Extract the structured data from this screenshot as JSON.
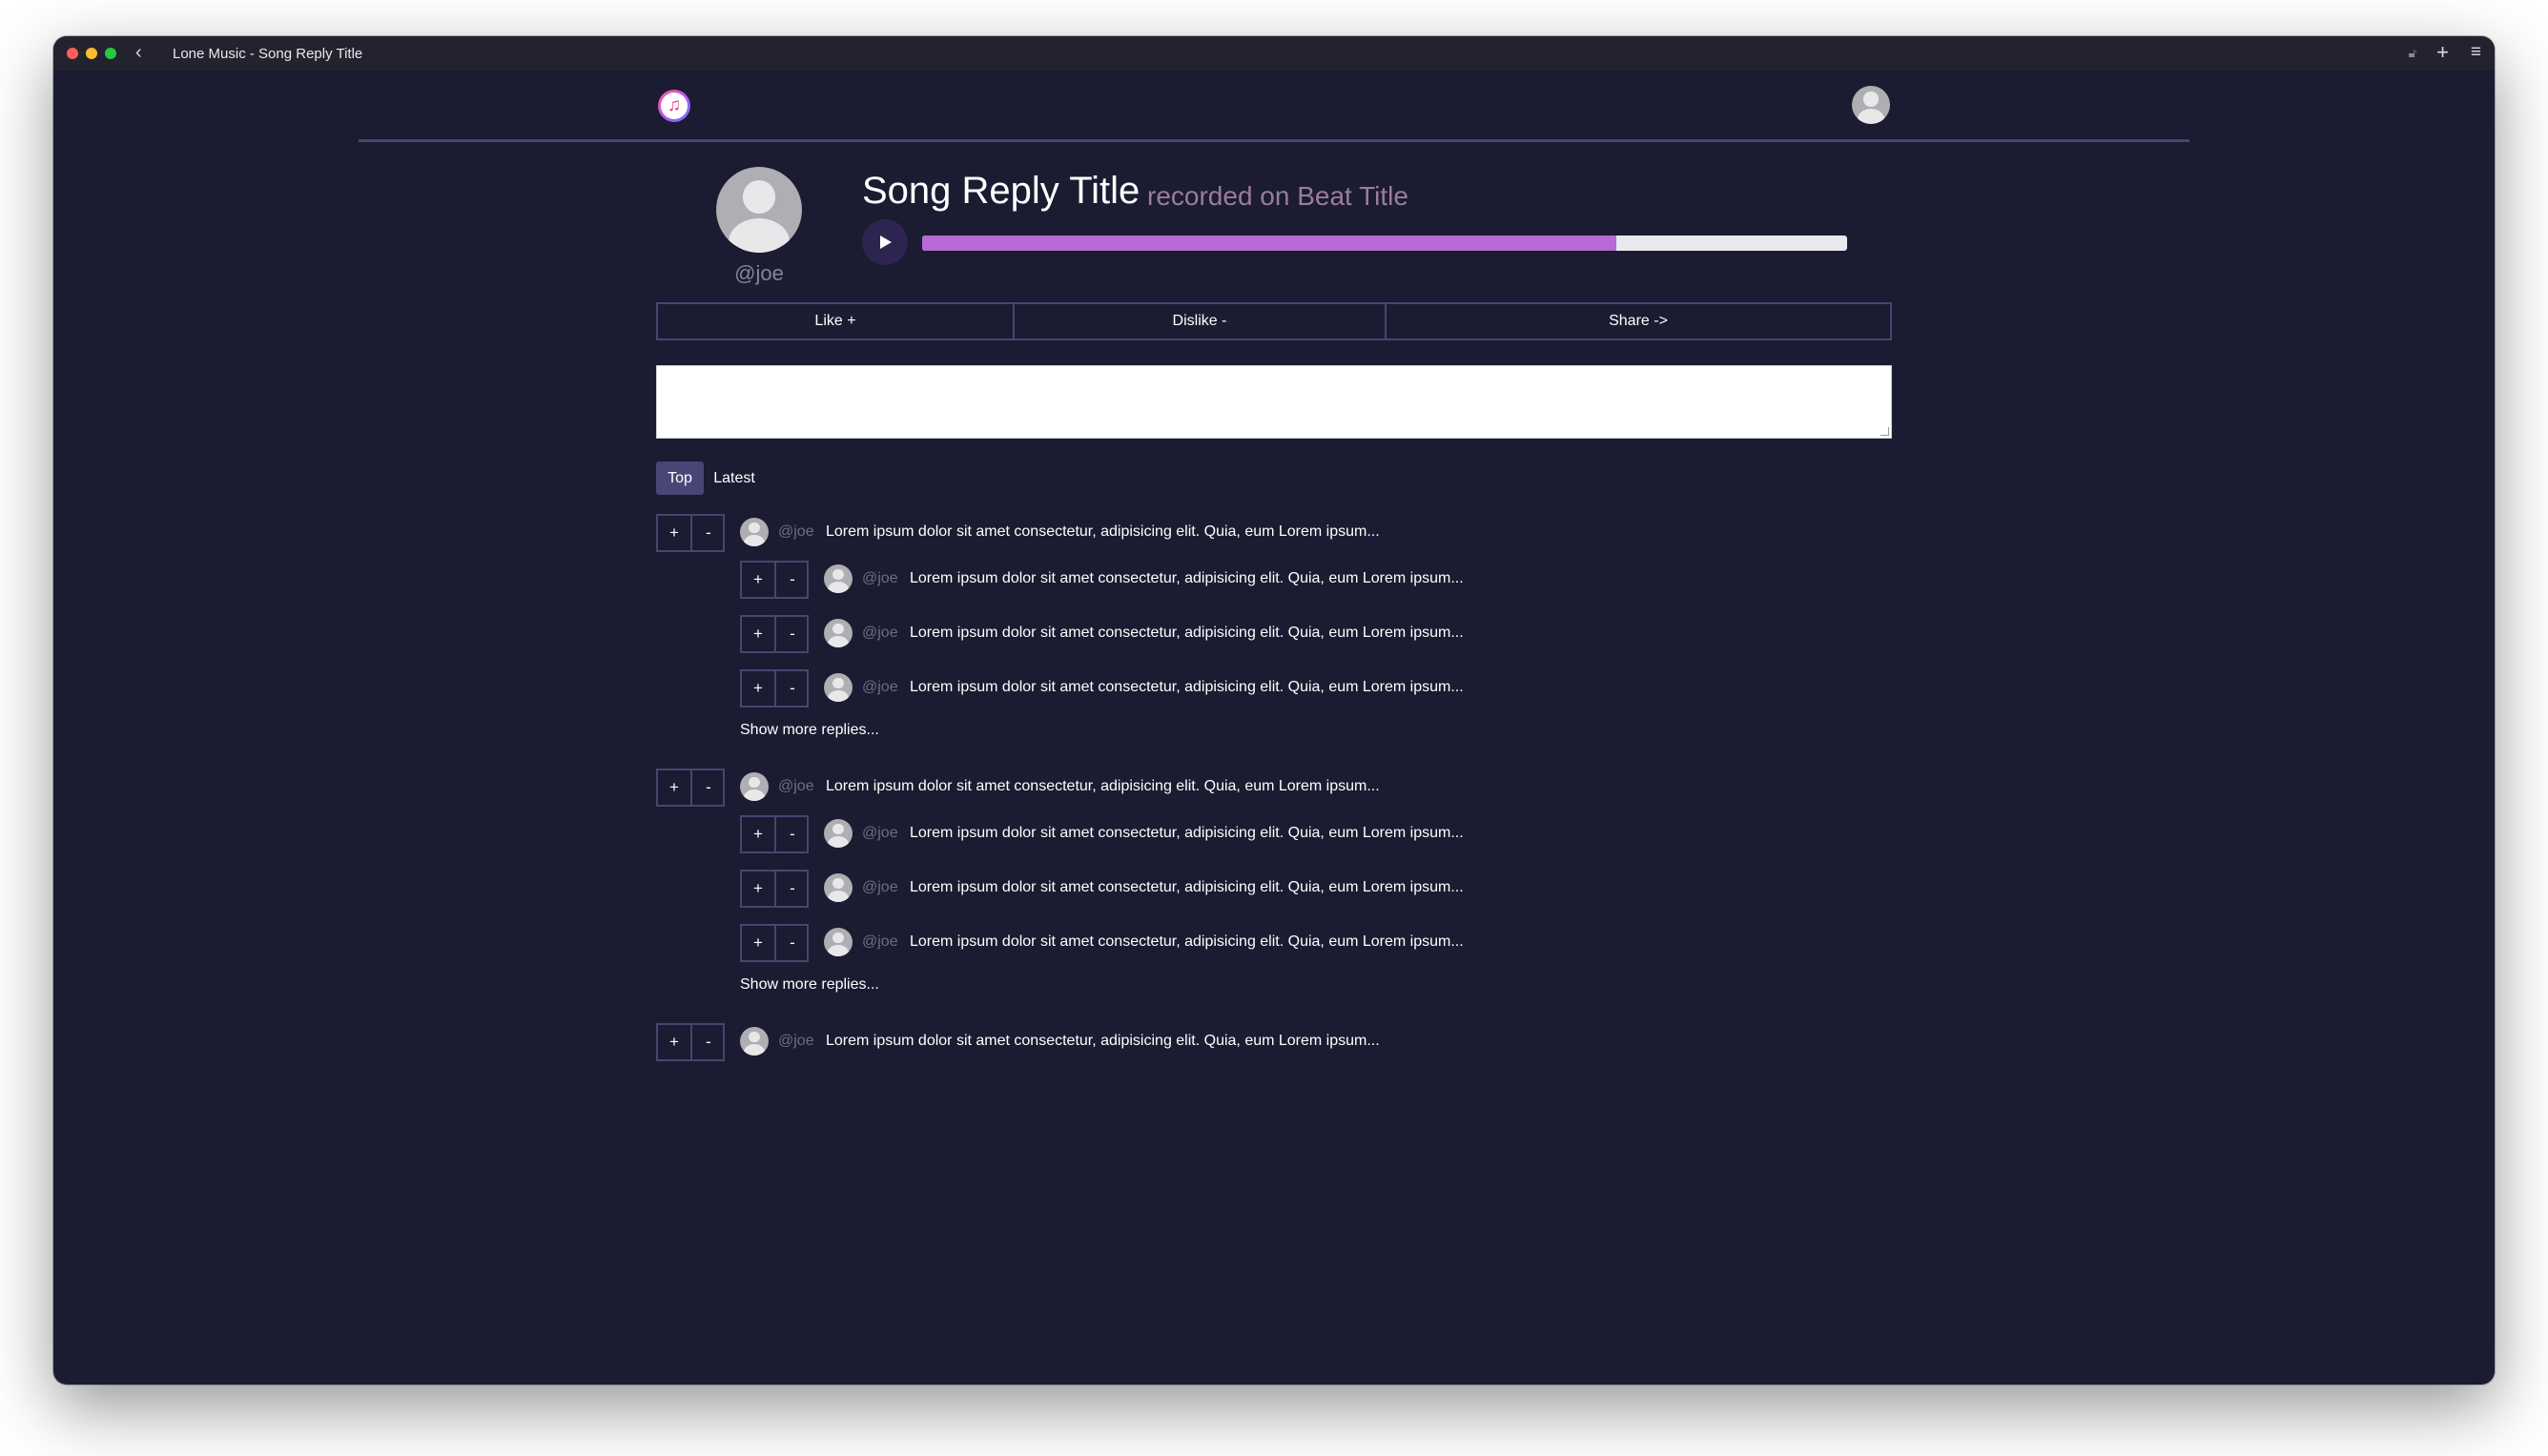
{
  "window": {
    "title": "Lone Music - Song Reply Title"
  },
  "header": {
    "logo_icon": "music-note-icon"
  },
  "song": {
    "title": "Song Reply Title",
    "recorded_on": "recorded on Beat Title",
    "author": "@joe",
    "progress": 0.75
  },
  "actions": {
    "like": "Like +",
    "dislike": "Dislike -",
    "share": "Share ->"
  },
  "reply": {
    "value": "",
    "placeholder": ""
  },
  "tabs": {
    "top": "Top",
    "latest": "Latest"
  },
  "comments": [
    {
      "user": "@joe",
      "text": "Lorem ipsum dolor sit amet consectetur, adipisicing elit. Quia, eum Lorem ipsum...",
      "replies": [
        {
          "user": "@joe",
          "text": "Lorem ipsum dolor sit amet consectetur, adipisicing elit. Quia, eum Lorem ipsum..."
        },
        {
          "user": "@joe",
          "text": "Lorem ipsum dolor sit amet consectetur, adipisicing elit. Quia, eum Lorem ipsum..."
        },
        {
          "user": "@joe",
          "text": "Lorem ipsum dolor sit amet consectetur, adipisicing elit. Quia, eum Lorem ipsum..."
        }
      ],
      "show_more": "Show more replies..."
    },
    {
      "user": "@joe",
      "text": "Lorem ipsum dolor sit amet consectetur, adipisicing elit. Quia, eum Lorem ipsum...",
      "replies": [
        {
          "user": "@joe",
          "text": "Lorem ipsum dolor sit amet consectetur, adipisicing elit. Quia, eum Lorem ipsum..."
        },
        {
          "user": "@joe",
          "text": "Lorem ipsum dolor sit amet consectetur, adipisicing elit. Quia, eum Lorem ipsum..."
        },
        {
          "user": "@joe",
          "text": "Lorem ipsum dolor sit amet consectetur, adipisicing elit. Quia, eum Lorem ipsum..."
        }
      ],
      "show_more": "Show more replies..."
    },
    {
      "user": "@joe",
      "text": "Lorem ipsum dolor sit amet consectetur, adipisicing elit. Quia, eum Lorem ipsum..."
    }
  ],
  "vote": {
    "up": "+",
    "down": "-"
  },
  "colors": {
    "background": "#1b1b31",
    "accent": "#474676",
    "progress_fill": "#b56ad6",
    "muted_text": "#85859a",
    "recorded_text": "#9a7d96"
  }
}
